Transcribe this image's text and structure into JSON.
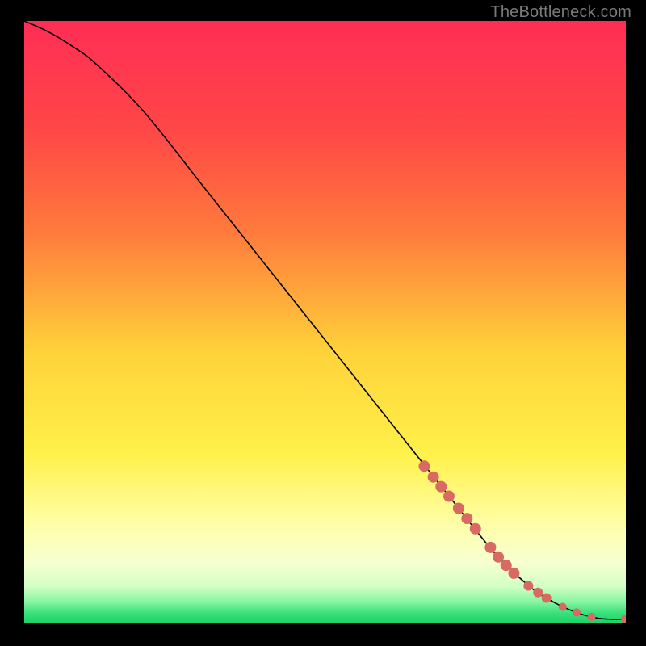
{
  "watermark": "TheBottleneck.com",
  "chart_data": {
    "type": "line",
    "title": "",
    "xlabel": "",
    "ylabel": "",
    "xlim": [
      0,
      100
    ],
    "ylim": [
      0,
      100
    ],
    "background_gradient": {
      "stops": [
        {
          "offset": 0.0,
          "color": "#ff2d55"
        },
        {
          "offset": 0.18,
          "color": "#ff4747"
        },
        {
          "offset": 0.35,
          "color": "#ff7a3c"
        },
        {
          "offset": 0.55,
          "color": "#ffd23a"
        },
        {
          "offset": 0.72,
          "color": "#fff14a"
        },
        {
          "offset": 0.84,
          "color": "#ffffaa"
        },
        {
          "offset": 0.9,
          "color": "#f7ffd0"
        },
        {
          "offset": 0.94,
          "color": "#d2ffc5"
        },
        {
          "offset": 0.965,
          "color": "#88f5a1"
        },
        {
          "offset": 0.985,
          "color": "#35e07a"
        },
        {
          "offset": 1.0,
          "color": "#1fd268"
        }
      ]
    },
    "series": [
      {
        "name": "bottleneck-curve",
        "x": [
          0,
          4,
          8,
          12,
          20,
          30,
          40,
          50,
          60,
          70,
          78,
          84,
          88,
          92,
          95,
          97.5,
          100
        ],
        "y": [
          100,
          98.2,
          95.8,
          92.8,
          84.8,
          72.2,
          59.6,
          47.0,
          34.4,
          21.8,
          11.8,
          6.0,
          3.4,
          1.6,
          0.8,
          0.55,
          0.55
        ]
      }
    ],
    "markers": {
      "name": "highlighted-points",
      "color": "#d86a63",
      "points": [
        {
          "x": 66.5,
          "y": 26.0,
          "r": 7
        },
        {
          "x": 68.0,
          "y": 24.2,
          "r": 7
        },
        {
          "x": 69.3,
          "y": 22.6,
          "r": 7
        },
        {
          "x": 70.6,
          "y": 21.0,
          "r": 7
        },
        {
          "x": 72.2,
          "y": 19.0,
          "r": 7
        },
        {
          "x": 73.6,
          "y": 17.3,
          "r": 7
        },
        {
          "x": 75.0,
          "y": 15.6,
          "r": 7
        },
        {
          "x": 77.5,
          "y": 12.5,
          "r": 7
        },
        {
          "x": 78.8,
          "y": 10.9,
          "r": 7
        },
        {
          "x": 80.1,
          "y": 9.5,
          "r": 7
        },
        {
          "x": 81.4,
          "y": 8.2,
          "r": 7
        },
        {
          "x": 83.8,
          "y": 6.1,
          "r": 6
        },
        {
          "x": 85.4,
          "y": 5.0,
          "r": 6
        },
        {
          "x": 86.8,
          "y": 4.1,
          "r": 6
        },
        {
          "x": 89.5,
          "y": 2.6,
          "r": 5
        },
        {
          "x": 91.8,
          "y": 1.7,
          "r": 5
        },
        {
          "x": 94.3,
          "y": 0.95,
          "r": 5
        },
        {
          "x": 100.0,
          "y": 0.55,
          "r": 6
        }
      ]
    }
  }
}
